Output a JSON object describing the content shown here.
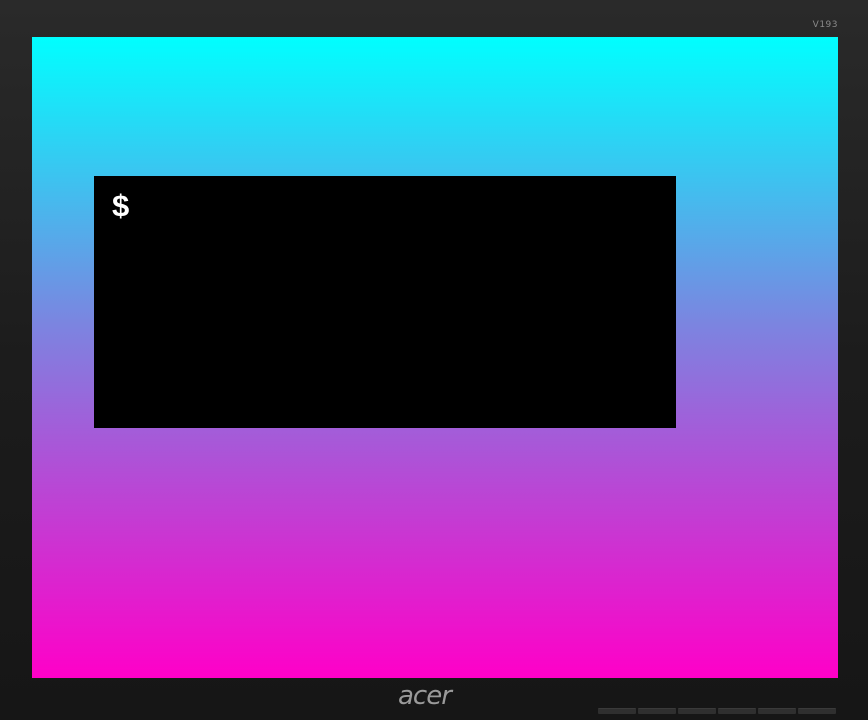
{
  "monitor": {
    "brand": "acer",
    "model": "V193",
    "button_count": 6
  },
  "screen": {
    "gradient_top": "#00ffff",
    "gradient_mid": "#7c84e0",
    "gradient_bottom": "#ff00c8"
  },
  "terminal": {
    "prompt": "$",
    "background": "#000000",
    "text_color": "#ffffff"
  }
}
